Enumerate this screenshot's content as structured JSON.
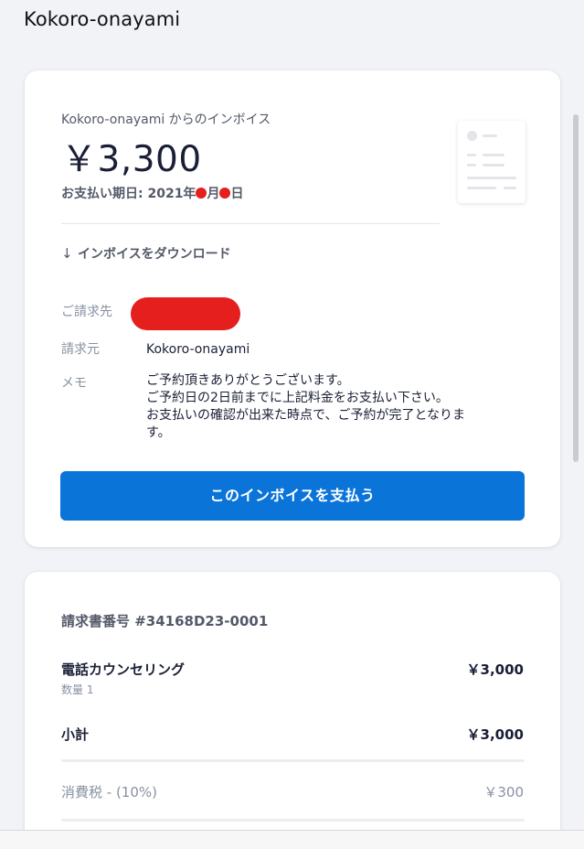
{
  "app": {
    "brand": "Kokoro-onayami"
  },
  "invoice": {
    "from_line": "Kokoro-onayami からのインボイス",
    "amount": "￥3,300",
    "due_prefix": "お支払い期日: 2021年",
    "due_mid": "月",
    "due_suffix": "日",
    "download_label": "インボイスをダウンロード",
    "download_icon": "↓",
    "bill_to_label": "ご請求先",
    "bill_from_label": "請求元",
    "bill_from_value": "Kokoro-onayami",
    "memo_label": "メモ",
    "memo_text": "ご予約頂きありがとうございます。\nご予約日の2日前までに上記料金をお支払い下さい。\nお支払いの確認が出来た時点で、ご予約が完了となります。",
    "pay_button": "このインボイスを支払う"
  },
  "summary": {
    "invoice_number": "請求書番号 #34168D23-0001",
    "items": [
      {
        "name": "電話カウンセリング",
        "qty": "数量 1",
        "amount": "￥3,000"
      }
    ],
    "subtotal_label": "小計",
    "subtotal_amount": "￥3,000",
    "tax_label": "消費税 - (10%)",
    "tax_amount": "￥300"
  },
  "colors": {
    "accent": "#0a74d9",
    "redaction": "#e51e1e",
    "background": "#f1f3f7"
  }
}
